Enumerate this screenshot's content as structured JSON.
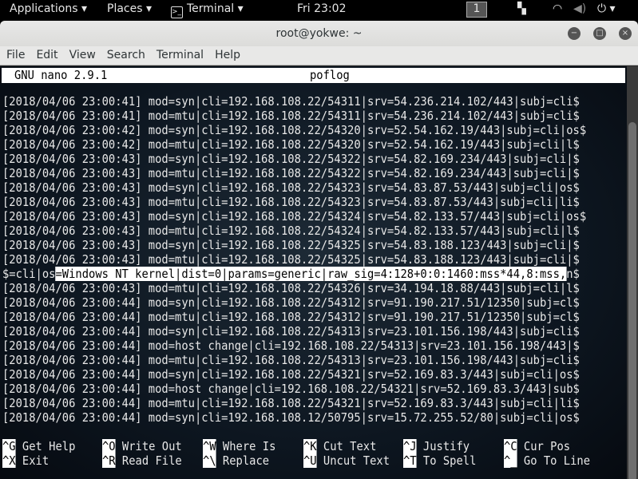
{
  "topbar": {
    "applications": "Applications ▾",
    "places": "Places ▾",
    "terminal": "Terminal ▾",
    "clock": "Fri 23:02",
    "workspace": "1"
  },
  "window": {
    "title": "root@yokwe: ~"
  },
  "menu": [
    "File",
    "Edit",
    "View",
    "Search",
    "Terminal",
    "Help"
  ],
  "nano": {
    "version": "GNU nano 2.9.1",
    "filename": "poflog"
  },
  "lines": [
    "[2018/04/06 23:00:41] mod=syn|cli=192.168.108.22/54311|srv=54.236.214.102/443|subj=cli$",
    "[2018/04/06 23:00:41] mod=mtu|cli=192.168.108.22/54311|srv=54.236.214.102/443|subj=cli$",
    "[2018/04/06 23:00:42] mod=syn|cli=192.168.108.22/54320|srv=52.54.162.19/443|subj=cli|os$",
    "[2018/04/06 23:00:42] mod=mtu|cli=192.168.108.22/54320|srv=52.54.162.19/443|subj=cli|l$",
    "[2018/04/06 23:00:43] mod=syn|cli=192.168.108.22/54322|srv=54.82.169.234/443|subj=cli|$",
    "[2018/04/06 23:00:43] mod=mtu|cli=192.168.108.22/54322|srv=54.82.169.234/443|subj=cli|$",
    "[2018/04/06 23:00:43] mod=syn|cli=192.168.108.22/54323|srv=54.83.87.53/443|subj=cli|os$",
    "[2018/04/06 23:00:43] mod=mtu|cli=192.168.108.22/54323|srv=54.83.87.53/443|subj=cli|li$",
    "[2018/04/06 23:00:43] mod=syn|cli=192.168.108.22/54324|srv=54.82.133.57/443|subj=cli|os$",
    "[2018/04/06 23:00:43] mod=mtu|cli=192.168.108.22/54324|srv=54.82.133.57/443|subj=cli|l$",
    "[2018/04/06 23:00:43] mod=syn|cli=192.168.108.22/54325|srv=54.83.188.123/443|subj=cli|$",
    "[2018/04/06 23:00:43] mod=mtu|cli=192.168.108.22/54325|srv=54.83.188.123/443|subj=cli|$"
  ],
  "hl_line": {
    "pre": "$=cli|os",
    "sel": "=Windows NT kernel|dist=0|params=generic|raw_sig=4:128+0:0:1460:mss*44,8:mss,",
    "post": "n$"
  },
  "lines2": [
    "[2018/04/06 23:00:43] mod=mtu|cli=192.168.108.22/54326|srv=34.194.18.88/443|subj=cli|l$",
    "[2018/04/06 23:00:44] mod=syn|cli=192.168.108.22/54312|srv=91.190.217.51/12350|subj=cl$",
    "[2018/04/06 23:00:44] mod=mtu|cli=192.168.108.22/54312|srv=91.190.217.51/12350|subj=cl$",
    "[2018/04/06 23:00:44] mod=syn|cli=192.168.108.22/54313|srv=23.101.156.198/443|subj=cli$",
    "[2018/04/06 23:00:44] mod=host change|cli=192.168.108.22/54313|srv=23.101.156.198/443|$",
    "[2018/04/06 23:00:44] mod=mtu|cli=192.168.108.22/54313|srv=23.101.156.198/443|subj=cli$",
    "[2018/04/06 23:00:44] mod=syn|cli=192.168.108.22/54321|srv=52.169.83.3/443|subj=cli|os$",
    "[2018/04/06 23:00:44] mod=host change|cli=192.168.108.22/54321|srv=52.169.83.3/443|sub$",
    "[2018/04/06 23:00:44] mod=mtu|cli=192.168.108.22/54321|srv=52.169.83.3/443|subj=cli|li$",
    "[2018/04/06 23:00:44] mod=syn|cli=192.168.108.12/50795|srv=15.72.255.52/80|subj=cli|os$"
  ],
  "shortcuts": [
    [
      {
        "k": "^G",
        "l": "Get Help"
      },
      {
        "k": "^O",
        "l": "Write Out"
      },
      {
        "k": "^W",
        "l": "Where Is"
      },
      {
        "k": "^K",
        "l": "Cut Text"
      },
      {
        "k": "^J",
        "l": "Justify"
      },
      {
        "k": "^C",
        "l": "Cur Pos"
      }
    ],
    [
      {
        "k": "^X",
        "l": "Exit"
      },
      {
        "k": "^R",
        "l": "Read File"
      },
      {
        "k": "^\\",
        "l": "Replace"
      },
      {
        "k": "^U",
        "l": "Uncut Text"
      },
      {
        "k": "^T",
        "l": "To Spell"
      },
      {
        "k": "^_",
        "l": "Go To Line"
      }
    ]
  ]
}
